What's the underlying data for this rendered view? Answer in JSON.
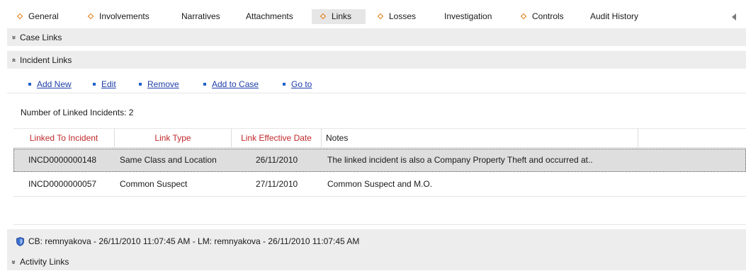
{
  "tabs": [
    {
      "label": "General",
      "marker": true,
      "active": false
    },
    {
      "label": "Involvements",
      "marker": true,
      "active": false
    },
    {
      "label": "Narratives",
      "marker": false,
      "active": false
    },
    {
      "label": "Attachments",
      "marker": false,
      "active": false
    },
    {
      "label": "Links",
      "marker": true,
      "active": true
    },
    {
      "label": "Losses",
      "marker": true,
      "active": false
    },
    {
      "label": "Investigation",
      "marker": false,
      "active": false
    },
    {
      "label": "Controls",
      "marker": true,
      "active": false
    },
    {
      "label": "Audit History",
      "marker": false,
      "active": false
    }
  ],
  "sections": {
    "case_links": "Case Links",
    "incident_links": "Incident Links",
    "activity_links": "Activity Links"
  },
  "actions": [
    "Add New",
    "Edit",
    "Remove",
    "Add to Case",
    "Go to"
  ],
  "linked_count_label": "Number of Linked Incidents: 2",
  "grid": {
    "columns": [
      "Linked To Incident",
      "Link Type",
      "Link Effective Date",
      "Notes"
    ],
    "rows": [
      {
        "incident": "INCD0000000148",
        "link_type": "Same Class and Location",
        "date": "26/11/2010",
        "notes": "The linked incident is also a Company Property Theft and occurred at..",
        "selected": true
      },
      {
        "incident": "INCD0000000057",
        "link_type": "Common Suspect",
        "date": "27/11/2010",
        "notes": "Common Suspect and M.O.",
        "selected": false
      }
    ]
  },
  "footer": "CB: remnyakova - 26/11/2010 11:07:45 AM - LM: remnyakova - 26/11/2010 11:07:45 AM",
  "colors": {
    "accent_marker": "#e07a10",
    "link": "#1f3ea8",
    "header_text": "#c0282b",
    "panel_bg": "#ededed"
  },
  "icons": {
    "collapsed_section": "double-chevron-down-icon",
    "expanded_section": "double-chevron-up-icon",
    "footer": "shield-icon",
    "tab_scroll": "triangle-left-icon"
  }
}
